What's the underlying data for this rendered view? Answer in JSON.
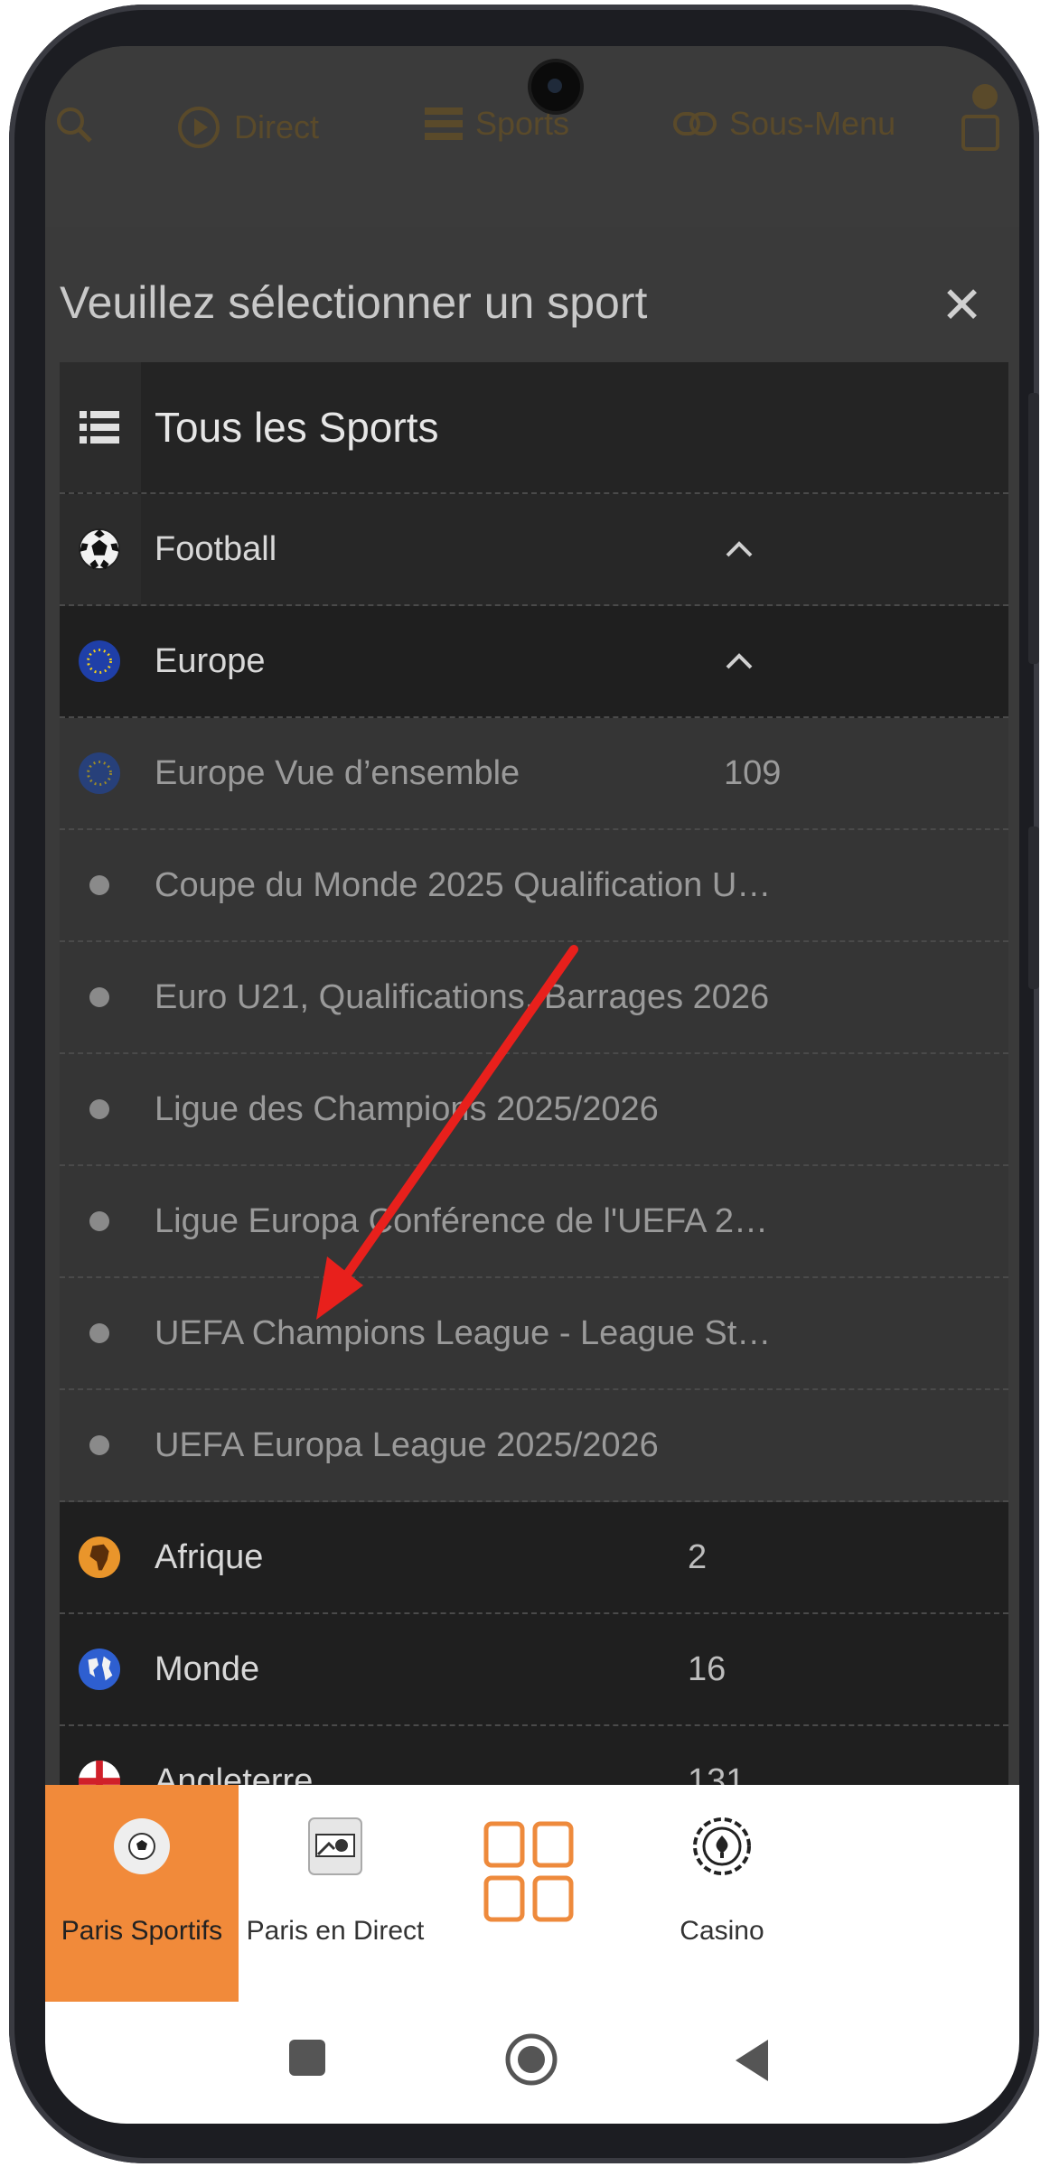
{
  "top_nav": {
    "items": [
      "Direct",
      "Sports",
      "Sous-Menu"
    ]
  },
  "modal": {
    "title": "Veuillez sélectionner un sport",
    "close": "✕"
  },
  "list": {
    "all_sports": "Tous les Sports",
    "sport": {
      "label": "Football"
    },
    "region": {
      "label": "Europe"
    },
    "leagues": [
      {
        "label": "Europe Vue d’ensemble",
        "count": "109"
      },
      {
        "label": "Coupe du Monde 2025 Qualification U…",
        "count": ""
      },
      {
        "label": "Euro U21, Qualifications, Barrages 2026",
        "count": ""
      },
      {
        "label": "Ligue des Champions 2025/2026",
        "count": ""
      },
      {
        "label": "Ligue Europa Conférence de l'UEFA 2…",
        "count": ""
      },
      {
        "label": "UEFA Champions League - League St…",
        "count": ""
      },
      {
        "label": "UEFA Europa League 2025/2026",
        "count": ""
      }
    ],
    "regions": [
      {
        "label": "Afrique",
        "count": "2"
      },
      {
        "label": "Monde",
        "count": "16"
      },
      {
        "label": "Angleterre",
        "count": "131"
      }
    ]
  },
  "bottom_tabs": [
    {
      "label": "Paris Sportifs",
      "icon": "football-icon"
    },
    {
      "label": "Paris en Direct",
      "icon": "live-betting-icon"
    },
    {
      "label": "",
      "icon": "grid-menu-icon"
    },
    {
      "label": "Casino",
      "icon": "casino-chip-icon"
    }
  ],
  "colors": {
    "accent": "#f18a3a",
    "annotation_arrow": "#e8201c"
  }
}
